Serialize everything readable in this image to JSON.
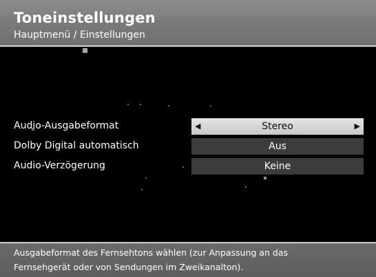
{
  "header": {
    "title": "Toneinstellungen",
    "breadcrumb": "Hauptmenü / Einstellungen"
  },
  "settings": [
    {
      "label": "Audio-Ausgabeformat",
      "value": "Stereo",
      "selected": true
    },
    {
      "label": "Dolby Digital automatisch",
      "value": "Aus",
      "selected": false
    },
    {
      "label": "Audio-Verzögerung",
      "value": "Keine",
      "selected": false
    }
  ],
  "help": {
    "line1": "Ausgabeformat des Fernsehtons wählen (zur Anpassung an das",
    "line2": "Fernsehgerät oder von Sendungen im Zweikanalton)."
  },
  "colors": {
    "header_bg": "#7a7a7a",
    "selected_bg": "#d4d4d4",
    "value_bg": "#3c3c3c",
    "footer_bg": "#636363"
  },
  "icons": {
    "left_arrow": "arrow-left-icon",
    "right_arrow": "arrow-right-icon"
  }
}
